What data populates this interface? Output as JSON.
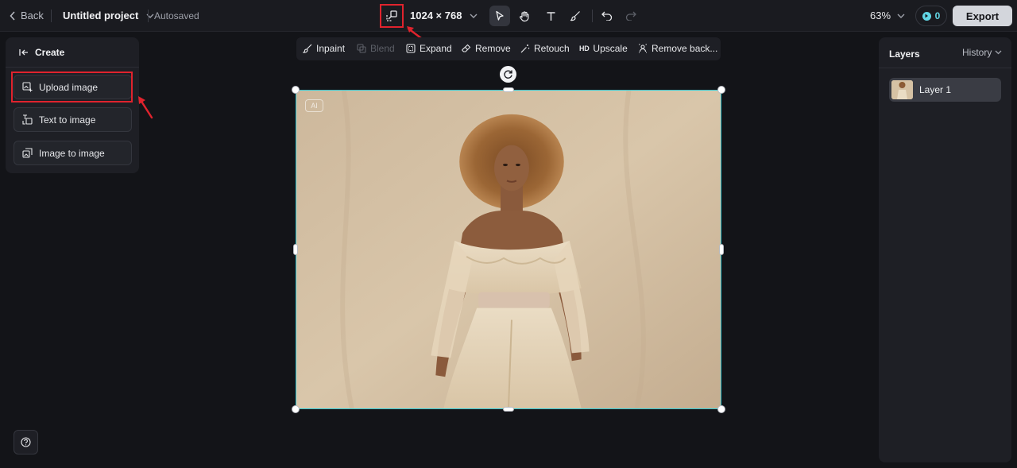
{
  "topbar": {
    "back_label": "Back",
    "project_title": "Untitled project",
    "autosave_status": "Autosaved",
    "canvas_size": "1024 × 768",
    "zoom": "63%",
    "credits": "0",
    "export_label": "Export",
    "tools": [
      {
        "name": "select-tool",
        "icon": "cursor-arrow-icon",
        "active": true
      },
      {
        "name": "hand-tool",
        "icon": "hand-icon",
        "active": false
      },
      {
        "name": "text-tool",
        "icon": "text-t-icon",
        "active": false
      },
      {
        "name": "brush-tool",
        "icon": "brush-icon",
        "active": false
      },
      {
        "name": "undo",
        "icon": "undo-icon",
        "active": false
      },
      {
        "name": "redo",
        "icon": "redo-icon",
        "active": false
      }
    ]
  },
  "left_panel": {
    "header": "Create",
    "items": [
      {
        "label": "Upload image",
        "icon": "upload-image-icon"
      },
      {
        "label": "Text to image",
        "icon": "text-to-image-icon"
      },
      {
        "label": "Image to image",
        "icon": "image-to-image-icon"
      }
    ]
  },
  "image_toolbar": {
    "items": [
      {
        "label": "Inpaint",
        "icon": "inpaint-brush-icon",
        "enabled": true
      },
      {
        "label": "Blend",
        "icon": "blend-icon",
        "enabled": false
      },
      {
        "label": "Expand",
        "icon": "expand-icon",
        "enabled": true
      },
      {
        "label": "Remove",
        "icon": "eraser-icon",
        "enabled": true
      },
      {
        "label": "Retouch",
        "icon": "retouch-wand-icon",
        "enabled": true
      },
      {
        "label": "Upscale",
        "icon": "hd-icon",
        "icon_text": "HD",
        "enabled": true
      },
      {
        "label": "Remove back...",
        "icon": "remove-background-icon",
        "enabled": true
      }
    ]
  },
  "canvas": {
    "ai_badge": "AI",
    "image_description": "AI generated fashion photo of a woman with curly hair in a cream off-shoulder outfit"
  },
  "right_panel": {
    "layers_tab": "Layers",
    "history_tab": "History",
    "layers": [
      {
        "name": "Layer 1"
      }
    ]
  },
  "colors": {
    "background": "#131418",
    "panel": "#1e1f25",
    "accent_selection": "#33c7d2",
    "highlight_annotation": "#e0232d",
    "export_button": "#d3d6dc"
  }
}
